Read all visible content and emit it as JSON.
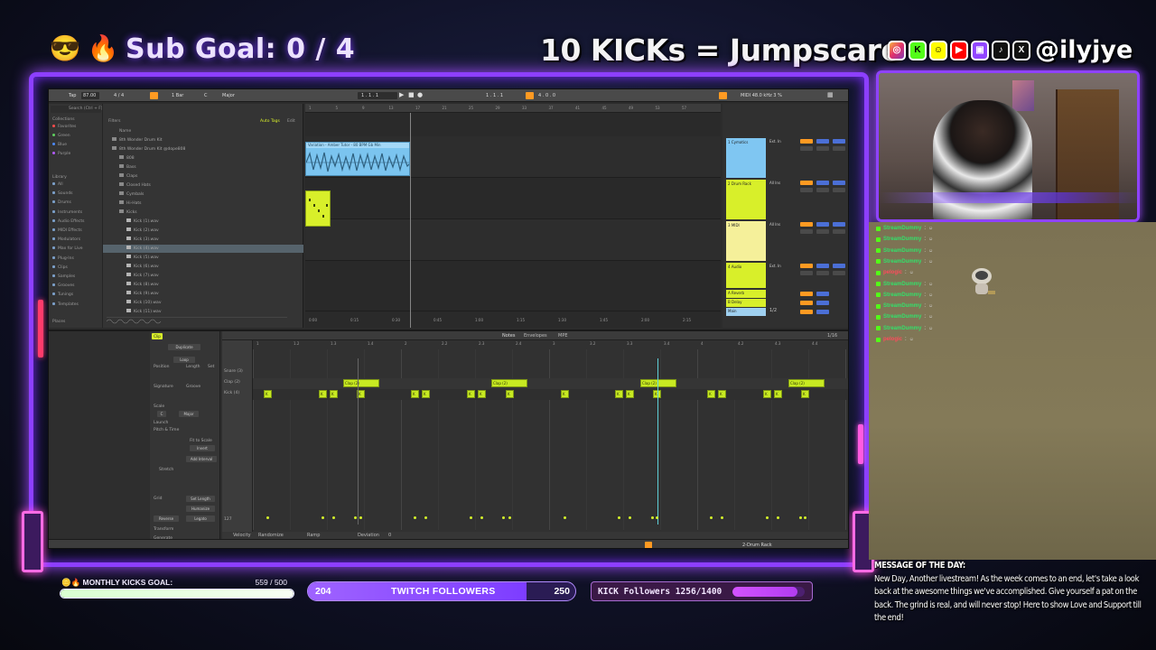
{
  "overlay": {
    "sub_goal": "Sub Goal: 0 / 4",
    "emoji_1": "😎",
    "emoji_2": "🔥",
    "jumpscare": "10 KICKs = Jumpscare",
    "social_icons": [
      "instagram-icon",
      "kick-icon",
      "snapchat-icon",
      "youtube-icon",
      "twitch-icon",
      "tiktok-icon",
      "x-icon"
    ],
    "handle": "@ilyjye",
    "frame_color": "#8d3fff"
  },
  "daw": {
    "toolbar": {
      "tap": "Tap",
      "tempo": "87.00",
      "time_sig": "4 / 4",
      "bar": "1 Bar",
      "key": "C",
      "scale": "Major",
      "position": "1 . 1 . 1",
      "loop_end": "4 . 0 . 0",
      "cpu": "MIDI  48.0 kHz  3 %"
    },
    "browser": {
      "search": "Search (Ctrl + F)",
      "filters": "Filters",
      "auto_tags": "Auto Tags",
      "edit": "Edit",
      "collections_header": "Collections",
      "collections": [
        "Favorites",
        "Green",
        "Blue",
        "Purple"
      ],
      "library_header": "Library",
      "library": [
        "All",
        "Sounds",
        "Drums",
        "Instruments",
        "Audio Effects",
        "MIDI Effects",
        "Modulators",
        "Max for Live",
        "Plug-Ins",
        "Clips",
        "Samples",
        "Grooves",
        "Tunings",
        "Templates"
      ],
      "places_header": "Places",
      "name_header": "Name",
      "files": [
        "8th Wonder Drum Kit",
        "8th Wonder Drum Kit @dope808",
        "808",
        "Bass",
        "Claps",
        "Closed Hats",
        "Cymbals",
        "Hi-Hats",
        "Kicks",
        "Kick (1).wav",
        "Kick (2).wav",
        "Kick (3).wav",
        "Kick (4).wav",
        "Kick (5).wav",
        "Kick (6).wav",
        "Kick (7).wav",
        "Kick (8).wav",
        "Kick (9).wav",
        "Kick (10).wav",
        "Kick (11).wav"
      ],
      "selected_index": 12
    },
    "arrangement": {
      "ruler": [
        "1",
        "5",
        "9",
        "13",
        "17",
        "21",
        "25",
        "29",
        "33",
        "37",
        "41",
        "45",
        "49",
        "53",
        "57"
      ],
      "audio_clip_name": "Variation - Amber Tutor - 80 BPM Gb Min",
      "time_labels": [
        "0:00",
        "0:15",
        "0:30",
        "0:45",
        "1:00",
        "1:15",
        "1:30",
        "1:45",
        "2:00",
        "2:15"
      ]
    },
    "mixer": {
      "tracks": [
        {
          "name": "1 Cymatics",
          "color": "#7fc6f2",
          "input": "Ext. In"
        },
        {
          "name": "2 Drum Rack",
          "color": "#d8ef2a",
          "input": "All Ins"
        },
        {
          "name": "3 MIDI",
          "color": "#f5f09a",
          "input": "All Ins"
        },
        {
          "name": "4 Audio",
          "color": "#d8ef2a",
          "input": "Ext. In"
        }
      ],
      "returns": [
        "A Reverb",
        "B Delay",
        "Main"
      ],
      "main_value": "1/2"
    },
    "clip": {
      "header": "Clip",
      "fold": "Fold",
      "duplicate": "Duplicate",
      "loop": "Loop",
      "position": "Position",
      "length": "Length",
      "set": "Set",
      "signature": "Signature",
      "groove": "Groove",
      "scale": "Scale",
      "scale_key": "C",
      "scale_name": "Major",
      "launch": "Launch",
      "pitch_time": "Pitch & Time",
      "fit_to_scale": "Fit to Scale",
      "invert": "Invert",
      "add_interval": "Add Interval",
      "stretch": "Stretch",
      "grid": "Grid",
      "set_length": "Set Length",
      "humanize": "Humanize",
      "reverse": "Reverse",
      "legato": "Legato",
      "transform": "Transform",
      "generate": "Generate"
    },
    "pianoroll": {
      "tabs": [
        "Notes",
        "Envelopes",
        "MPE"
      ],
      "ruler": [
        "1",
        "1.2",
        "1.3",
        "1.4",
        "2",
        "2.2",
        "2.3",
        "2.4",
        "3",
        "3.2",
        "3.3",
        "3.4",
        "4",
        "4.2",
        "4.3",
        "4.4"
      ],
      "lanes": [
        "Snare (3)",
        "Clap (2)",
        "Kick (4)"
      ],
      "clap_label": "Clap (2)",
      "kick_label": "K",
      "velocity_label": "127",
      "bottom": [
        "Velocity",
        "Randomize",
        "Ramp",
        "Deviation"
      ],
      "deviation": "0",
      "zoom": "1/16"
    },
    "status_track": "2-Drum Rack"
  },
  "chat": {
    "messages": [
      {
        "user": "StreamDummy",
        "color": "#33e06a"
      },
      {
        "user": "StreamDummy",
        "color": "#33e06a"
      },
      {
        "user": "StreamDummy",
        "color": "#33e06a"
      },
      {
        "user": "StreamDummy",
        "color": "#33e06a"
      },
      {
        "user": "pelogic",
        "color": "#ff4b5c"
      },
      {
        "user": "StreamDummy",
        "color": "#33e06a"
      },
      {
        "user": "StreamDummy",
        "color": "#33e06a"
      },
      {
        "user": "StreamDummy",
        "color": "#33e06a"
      },
      {
        "user": "StreamDummy",
        "color": "#33e06a"
      },
      {
        "user": "StreamDummy",
        "color": "#33e06a"
      },
      {
        "user": "pelogic",
        "color": "#ff4b5c"
      }
    ],
    "separator": ":"
  },
  "motd": {
    "title": "MESSAGE OF THE DAY:",
    "body": "New Day, Another livestream! As the week comes to an end, let's take a look back at the awesome things we've accomplished. Give yourself a pat on the back. The grind is real, and will never stop! Here to show Love and Support till the end!"
  },
  "monthly_goal": {
    "label": "MONTHLY KICKS GOAL:",
    "count": "559 / 500",
    "progress": 1.0
  },
  "twitch": {
    "current": "204",
    "label": "TWITCH FOLLOWERS",
    "goal": "250",
    "progress": 0.816
  },
  "kick": {
    "label": "KICK Followers 1256/1400",
    "progress": 0.897
  }
}
